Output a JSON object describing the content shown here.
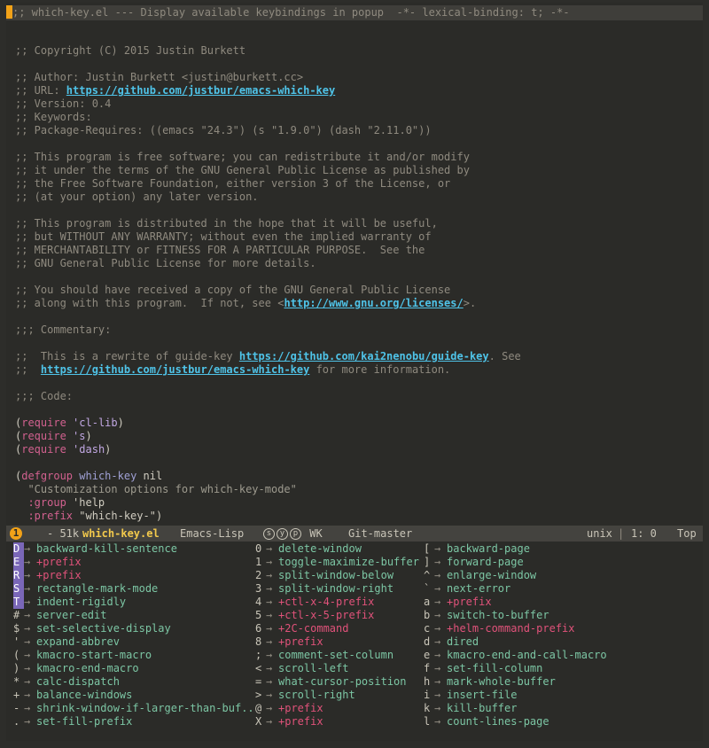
{
  "header": {
    "text": ";; which-key.el --- Display available keybindings in popup  -*- lexical-binding: t; -*-"
  },
  "editor_lines": [
    {
      "t": "blank"
    },
    {
      "t": "comment",
      "text": ";; Copyright (C) 2015 Justin Burkett"
    },
    {
      "t": "blank"
    },
    {
      "t": "comment",
      "text": ";; Author: Justin Burkett <justin@burkett.cc>"
    },
    {
      "t": "url",
      "pre": ";; URL: ",
      "url": "https://github.com/justbur/emacs-which-key",
      "post": ""
    },
    {
      "t": "comment",
      "text": ";; Version: 0.4"
    },
    {
      "t": "comment",
      "text": ";; Keywords:"
    },
    {
      "t": "comment",
      "text": ";; Package-Requires: ((emacs \"24.3\") (s \"1.9.0\") (dash \"2.11.0\"))"
    },
    {
      "t": "blank"
    },
    {
      "t": "comment",
      "text": ";; This program is free software; you can redistribute it and/or modify"
    },
    {
      "t": "comment",
      "text": ";; it under the terms of the GNU General Public License as published by"
    },
    {
      "t": "comment",
      "text": ";; the Free Software Foundation, either version 3 of the License, or"
    },
    {
      "t": "comment",
      "text": ";; (at your option) any later version."
    },
    {
      "t": "blank"
    },
    {
      "t": "comment",
      "text": ";; This program is distributed in the hope that it will be useful,"
    },
    {
      "t": "comment",
      "text": ";; but WITHOUT ANY WARRANTY; without even the implied warranty of"
    },
    {
      "t": "comment",
      "text": ";; MERCHANTABILITY or FITNESS FOR A PARTICULAR PURPOSE.  See the"
    },
    {
      "t": "comment",
      "text": ";; GNU General Public License for more details."
    },
    {
      "t": "blank"
    },
    {
      "t": "comment",
      "text": ";; You should have received a copy of the GNU General Public License"
    },
    {
      "t": "url",
      "pre": ";; along with this program.  If not, see <",
      "url": "http://www.gnu.org/licenses/",
      "post": ">."
    },
    {
      "t": "blank"
    },
    {
      "t": "comment",
      "text": ";;; Commentary:"
    },
    {
      "t": "blank"
    },
    {
      "t": "url",
      "pre": ";;  This is a rewrite of guide-key ",
      "url": "https://github.com/kai2nenobu/guide-key",
      "post": ". See"
    },
    {
      "t": "url",
      "pre": ";;  ",
      "url": "https://github.com/justbur/emacs-which-key",
      "post": " for more information."
    },
    {
      "t": "blank"
    },
    {
      "t": "comment",
      "text": ";;; Code:"
    },
    {
      "t": "blank"
    },
    {
      "t": "require",
      "kw": "require",
      "sym": "'cl-lib"
    },
    {
      "t": "require",
      "kw": "require",
      "sym": "'s"
    },
    {
      "t": "require",
      "kw": "require",
      "sym": "'dash"
    },
    {
      "t": "blank"
    },
    {
      "t": "defgroup",
      "kw": "defgroup",
      "name": "which-key",
      "rest": " nil"
    },
    {
      "t": "string",
      "text": "  \"Customization options for which-key-mode\""
    },
    {
      "t": "kwarg",
      "key": "  :group",
      "val": " 'help"
    },
    {
      "t": "kwarg",
      "key": "  :prefix",
      "val": " \"which-key-\")"
    }
  ],
  "modeline": {
    "window_number": "1",
    "status": "- 51k",
    "buffer_name": "which-key.el",
    "major_mode": "Emacs-Lisp",
    "minor_icons": [
      "s",
      "y",
      "p"
    ],
    "minor_text": "WK",
    "vc": "Git-master",
    "encoding": "unix",
    "position": "1: 0",
    "scroll": "Top"
  },
  "which_key": {
    "arrow": "→",
    "columns": [
      [
        {
          "key": "D",
          "cmd": "backward-kill-sentence",
          "prefix": false,
          "hl": true
        },
        {
          "key": "E",
          "cmd": "+prefix",
          "prefix": true,
          "hl": true
        },
        {
          "key": "R",
          "cmd": "+prefix",
          "prefix": true,
          "hl": true
        },
        {
          "key": "S",
          "cmd": "rectangle-mark-mode",
          "prefix": false,
          "hl": true
        },
        {
          "key": "T",
          "cmd": "indent-rigidly",
          "prefix": false,
          "hl": true
        },
        {
          "key": "#",
          "cmd": "server-edit",
          "prefix": false,
          "hl": false
        },
        {
          "key": "$",
          "cmd": "set-selective-display",
          "prefix": false,
          "hl": false
        },
        {
          "key": "'",
          "cmd": "expand-abbrev",
          "prefix": false,
          "hl": false
        },
        {
          "key": "(",
          "cmd": "kmacro-start-macro",
          "prefix": false,
          "hl": false
        },
        {
          "key": ")",
          "cmd": "kmacro-end-macro",
          "prefix": false,
          "hl": false
        },
        {
          "key": "*",
          "cmd": "calc-dispatch",
          "prefix": false,
          "hl": false
        },
        {
          "key": "+",
          "cmd": "balance-windows",
          "prefix": false,
          "hl": false
        },
        {
          "key": "-",
          "cmd": "shrink-window-if-larger-than-buf..",
          "prefix": false,
          "hl": false
        },
        {
          "key": ".",
          "cmd": "set-fill-prefix",
          "prefix": false,
          "hl": false
        }
      ],
      [
        {
          "key": "0",
          "cmd": "delete-window",
          "prefix": false,
          "hl": false
        },
        {
          "key": "1",
          "cmd": "toggle-maximize-buffer",
          "prefix": false,
          "hl": false
        },
        {
          "key": "2",
          "cmd": "split-window-below",
          "prefix": false,
          "hl": false
        },
        {
          "key": "3",
          "cmd": "split-window-right",
          "prefix": false,
          "hl": false
        },
        {
          "key": "4",
          "cmd": "+ctl-x-4-prefix",
          "prefix": true,
          "hl": false
        },
        {
          "key": "5",
          "cmd": "+ctl-x-5-prefix",
          "prefix": true,
          "hl": false
        },
        {
          "key": "6",
          "cmd": "+2C-command",
          "prefix": true,
          "hl": false
        },
        {
          "key": "8",
          "cmd": "+prefix",
          "prefix": true,
          "hl": false
        },
        {
          "key": ";",
          "cmd": "comment-set-column",
          "prefix": false,
          "hl": false
        },
        {
          "key": "<",
          "cmd": "scroll-left",
          "prefix": false,
          "hl": false
        },
        {
          "key": "=",
          "cmd": "what-cursor-position",
          "prefix": false,
          "hl": false
        },
        {
          "key": ">",
          "cmd": "scroll-right",
          "prefix": false,
          "hl": false
        },
        {
          "key": "@",
          "cmd": "+prefix",
          "prefix": true,
          "hl": false
        },
        {
          "key": "X",
          "cmd": "+prefix",
          "prefix": true,
          "hl": false
        }
      ],
      [
        {
          "key": "[",
          "cmd": "backward-page",
          "prefix": false,
          "hl": false
        },
        {
          "key": "]",
          "cmd": "forward-page",
          "prefix": false,
          "hl": false
        },
        {
          "key": "^",
          "cmd": "enlarge-window",
          "prefix": false,
          "hl": false
        },
        {
          "key": "`",
          "cmd": "next-error",
          "prefix": false,
          "hl": false
        },
        {
          "key": "a",
          "cmd": "+prefix",
          "prefix": true,
          "hl": false
        },
        {
          "key": "b",
          "cmd": "switch-to-buffer",
          "prefix": false,
          "hl": false
        },
        {
          "key": "c",
          "cmd": "+helm-command-prefix",
          "prefix": true,
          "hl": false
        },
        {
          "key": "d",
          "cmd": "dired",
          "prefix": false,
          "hl": false
        },
        {
          "key": "e",
          "cmd": "kmacro-end-and-call-macro",
          "prefix": false,
          "hl": false
        },
        {
          "key": "f",
          "cmd": "set-fill-column",
          "prefix": false,
          "hl": false
        },
        {
          "key": "h",
          "cmd": "mark-whole-buffer",
          "prefix": false,
          "hl": false
        },
        {
          "key": "i",
          "cmd": "insert-file",
          "prefix": false,
          "hl": false
        },
        {
          "key": "k",
          "cmd": "kill-buffer",
          "prefix": false,
          "hl": false
        },
        {
          "key": "l",
          "cmd": "count-lines-page",
          "prefix": false,
          "hl": false
        }
      ]
    ]
  },
  "colors": {
    "background": "#2b2b28",
    "comment": "#8f8a7f",
    "url": "#4fc3e8",
    "keyword": "#d2618f",
    "command": "#7cc6a4",
    "prefix": "#e0527a",
    "key_highlight": "#7a67b8",
    "cursor": "#f2a218"
  }
}
